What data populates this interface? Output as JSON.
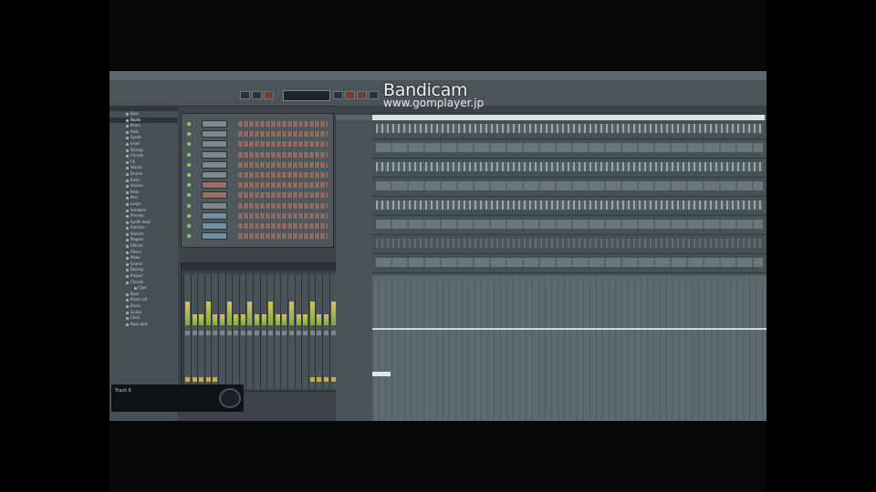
{
  "watermark": {
    "title": "Bandicam",
    "url": "www.gomplayer.jp"
  },
  "notification": {
    "text": "Track 6"
  },
  "browser": {
    "items": [
      "Bass",
      "Beats",
      "Piano",
      "Pads",
      "Synth",
      "Lead",
      "Strings",
      "Chords",
      "FX",
      "Vocals",
      "Drums",
      "Kicks",
      "Snares",
      "Hats",
      "Perc",
      "Loops",
      "Samples",
      "Presets",
      "Synth lead",
      "Patches",
      "Sounds",
      "Plugins",
      "Effects",
      "Filters",
      "Mixer",
      "Scores",
      "Backup",
      "Project",
      "Chords",
      "Clips",
      "Keys",
      "Piano roll",
      "Brass",
      "Guitar",
      "Choir",
      "Keys pad"
    ],
    "selected": "Beats"
  },
  "channels": [
    "",
    "",
    "",
    "",
    "",
    "",
    "",
    "",
    "",
    "",
    "",
    ""
  ],
  "colors": {
    "meter": "#8fd157",
    "pad": "#8d6b63",
    "accent": "#c7a952"
  }
}
